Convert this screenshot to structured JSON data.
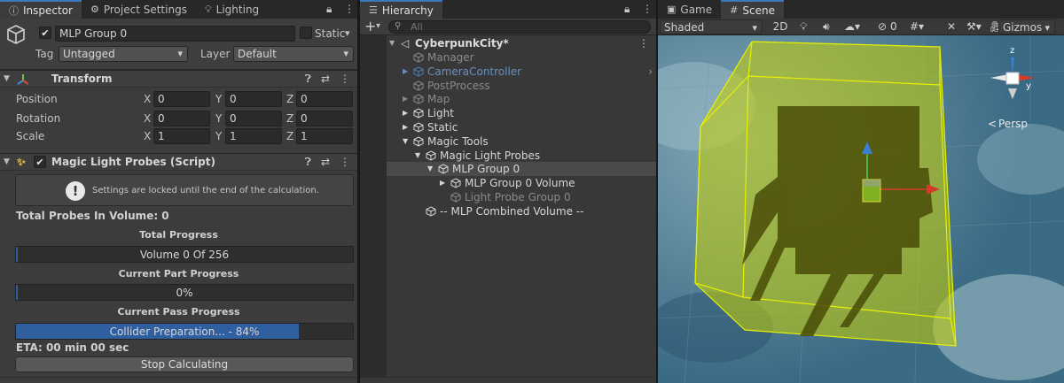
{
  "inspector": {
    "tabs": [
      {
        "label": "Inspector",
        "icon": "info-icon"
      },
      {
        "label": "Project Settings",
        "icon": "gear-icon"
      },
      {
        "label": "Lighting",
        "icon": "bulb-icon"
      }
    ],
    "object": {
      "name": "MLP Group 0",
      "static_label": "Static",
      "tag_label": "Tag",
      "tag_value": "Untagged",
      "layer_label": "Layer",
      "layer_value": "Default"
    },
    "transform": {
      "title": "Transform",
      "rows": [
        {
          "label": "Position",
          "x": "0",
          "y": "0",
          "z": "0"
        },
        {
          "label": "Rotation",
          "x": "0",
          "y": "0",
          "z": "0"
        },
        {
          "label": "Scale",
          "x": "1",
          "y": "1",
          "z": "1"
        }
      ],
      "axis_x": "X",
      "axis_y": "Y",
      "axis_z": "Z"
    },
    "script": {
      "title": "Magic Light Probes (Script)",
      "notice": "Settings are locked until the end of the calculation.",
      "total_probes": "Total Probes In Volume: 0",
      "total_progress_title": "Total Progress",
      "total_progress_text": "Volume 0 Of 256",
      "total_progress_value": 0.4,
      "part_progress_title": "Current Part Progress",
      "part_progress_text": "0%",
      "part_progress_value": 0.4,
      "pass_progress_title": "Current Pass Progress",
      "pass_progress_text": "Collider Preparation... - 84%",
      "pass_progress_value": 84,
      "eta": "ETA:  00 min 00 sec",
      "stop_button": "Stop Calculating"
    }
  },
  "hierarchy": {
    "tab_label": "Hierarchy",
    "add_label": "+",
    "search_placeholder": "All",
    "scene_name": "CyberpunkCity*",
    "items": [
      {
        "label": "Manager",
        "state": "disabled",
        "depth": 1,
        "arrow": false
      },
      {
        "label": "CameraController",
        "state": "prefab-disabled",
        "depth": 1,
        "arrow": true
      },
      {
        "label": "PostProcess",
        "state": "disabled",
        "depth": 1,
        "arrow": false
      },
      {
        "label": "Map",
        "state": "disabled",
        "depth": 1,
        "arrow": true
      },
      {
        "label": "Light",
        "state": "normal",
        "depth": 1,
        "arrow": true
      },
      {
        "label": "Static",
        "state": "normal",
        "depth": 1,
        "arrow": true
      },
      {
        "label": "Magic Tools",
        "state": "normal",
        "depth": 1,
        "arrow": "open"
      },
      {
        "label": "Magic Light Probes",
        "state": "normal",
        "depth": 2,
        "arrow": "open"
      },
      {
        "label": "MLP Group 0",
        "state": "selected",
        "depth": 3,
        "arrow": "open"
      },
      {
        "label": "MLP Group 0 Volume",
        "state": "normal",
        "depth": 4,
        "arrow": true
      },
      {
        "label": "Light Probe Group 0",
        "state": "disabled",
        "depth": 4,
        "arrow": false
      },
      {
        "label": "-- MLP Combined Volume --",
        "state": "normal",
        "depth": 2,
        "arrow": false
      }
    ]
  },
  "scene": {
    "tabs": [
      {
        "label": "Game",
        "icon": "gamepad-icon"
      },
      {
        "label": "Scene",
        "icon": "grid-icon"
      }
    ],
    "shading": "Shaded",
    "mode_2d": "2D",
    "hidden_count": "0",
    "gizmos": "Gizmos",
    "persp_label": "Persp",
    "axis_y": "y",
    "axis_z": "z",
    "colors": {
      "volume": "#c8d200",
      "sky": "#3a6a86"
    }
  }
}
